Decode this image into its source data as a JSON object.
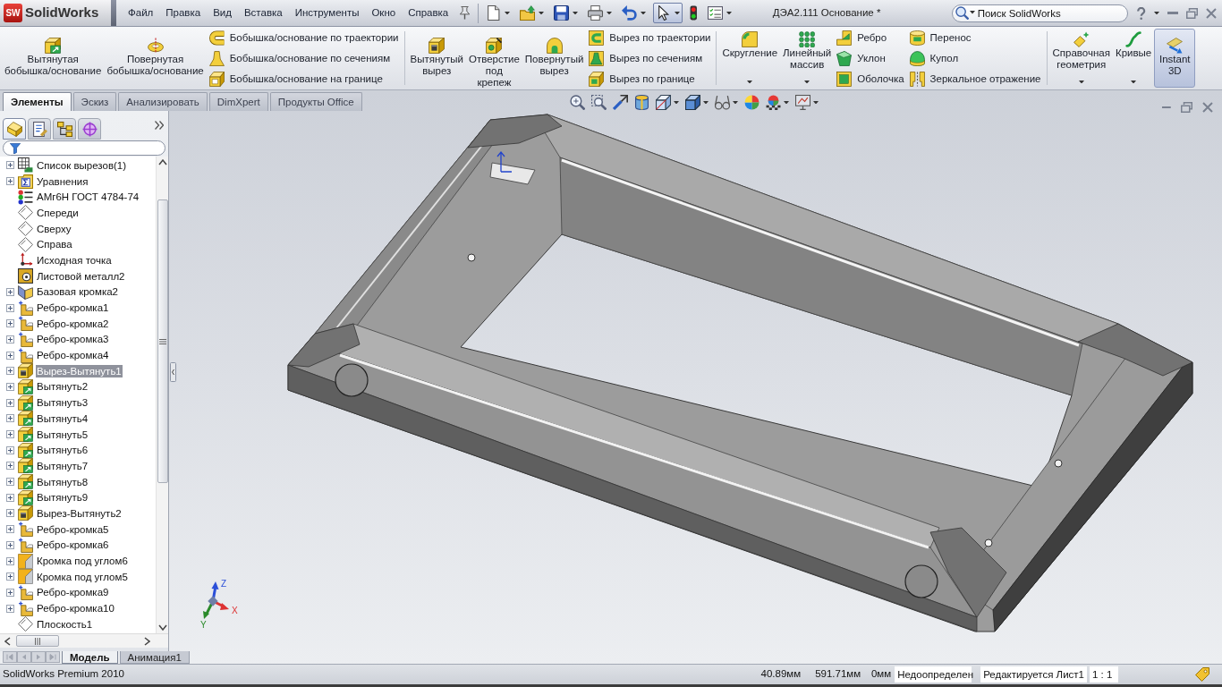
{
  "title_bar": {
    "logo_badge": "SW",
    "logo_text": "SolidWorks",
    "menu": [
      "Файл",
      "Правка",
      "Вид",
      "Вставка",
      "Инструменты",
      "Окно",
      "Справка"
    ],
    "quick_access": [
      {
        "kind": "new",
        "dropdown": true,
        "selected": false
      },
      {
        "kind": "open",
        "dropdown": true,
        "selected": false
      },
      {
        "kind": "save",
        "dropdown": true,
        "selected": false
      },
      {
        "kind": "print",
        "dropdown": true,
        "selected": false
      },
      {
        "kind": "undo",
        "dropdown": true,
        "selected": false
      },
      {
        "kind": "select",
        "dropdown": true,
        "selected": true
      },
      {
        "kind": "rebuild",
        "dropdown": false,
        "selected": false
      },
      {
        "kind": "options",
        "dropdown": true,
        "selected": false
      }
    ],
    "document_title": "ДЭА2.111 Основание *",
    "search": {
      "placeholder": "Поиск SolidWorks"
    }
  },
  "ribbon": {
    "groups": [
      {
        "controls": [
          {
            "kind": "extruded-boss",
            "label": "Вытянутая\nбобышка/основание",
            "dropdown": false,
            "on": false
          },
          {
            "kind": "revolved-boss",
            "label": "Повернутая\nбобышка/основание",
            "dropdown": false,
            "on": false
          },
          {
            "items": [
              {
                "kind": "swept-boss",
                "label": "Бобышка/основание по траектории"
              },
              {
                "kind": "lofted-boss",
                "label": "Бобышка/основание по сечениям"
              },
              {
                "kind": "boundary-boss",
                "label": "Бобышка/основание на границе"
              }
            ]
          }
        ]
      },
      {
        "controls": [
          {
            "kind": "extruded-cut",
            "label": "Вытянутый\nвырез",
            "dropdown": false,
            "on": false
          },
          {
            "kind": "hole-wizard",
            "label": "Отверстие\nпод\nкрепеж",
            "dropdown": false,
            "on": false
          },
          {
            "kind": "revolved-cut",
            "label": "Повернутый\nвырез",
            "dropdown": false,
            "on": false
          },
          {
            "items": [
              {
                "kind": "swept-cut",
                "label": "Вырез по траектории"
              },
              {
                "kind": "lofted-cut",
                "label": "Вырез по сечениям"
              },
              {
                "kind": "boundary-cut",
                "label": "Вырез по границе"
              }
            ]
          }
        ]
      },
      {
        "controls": [
          {
            "kind": "fillet",
            "label": "Скругление",
            "dropdown": true,
            "on": false
          },
          {
            "kind": "linear-pattern",
            "label": "Линейный\nмассив",
            "dropdown": true,
            "on": false
          },
          {
            "items": [
              {
                "kind": "rib",
                "label": "Ребро"
              },
              {
                "kind": "draft",
                "label": "Уклон"
              },
              {
                "kind": "shell",
                "label": "Оболочка"
              }
            ]
          },
          {
            "items": [
              {
                "kind": "wrap",
                "label": "Перенос"
              },
              {
                "kind": "dome",
                "label": "Купол"
              },
              {
                "kind": "mirror",
                "label": "Зеркальное отражение"
              }
            ]
          }
        ]
      },
      {
        "controls": [
          {
            "kind": "reference-geometry",
            "label": "Справочная\nгеометрия",
            "dropdown": true,
            "on": false
          },
          {
            "kind": "curves",
            "label": "Кривые",
            "dropdown": true,
            "on": false
          },
          {
            "kind": "instant-3d",
            "label": "Instant\n3D",
            "dropdown": false,
            "on": true
          }
        ]
      }
    ]
  },
  "command_tabs": [
    {
      "label": "Элементы",
      "selected": true
    },
    {
      "label": "Эскиз",
      "selected": false
    },
    {
      "label": "Анализировать",
      "selected": false
    },
    {
      "label": "DimXpert",
      "selected": false
    },
    {
      "label": "Продукты Office",
      "selected": false
    }
  ],
  "view_toolbar": [
    {
      "kind": "zoom-fit",
      "dropdown": false
    },
    {
      "kind": "zoom-area",
      "dropdown": false
    },
    {
      "kind": "previous-view",
      "dropdown": false
    },
    {
      "kind": "section",
      "dropdown": false
    },
    {
      "kind": "orientation",
      "dropdown": true
    },
    {
      "kind": "display-style",
      "dropdown": true
    },
    {
      "kind": "hide-show",
      "dropdown": true
    },
    {
      "kind": "appearance",
      "dropdown": false
    },
    {
      "kind": "scene",
      "dropdown": true
    },
    {
      "kind": "view-settings",
      "dropdown": true
    }
  ],
  "feature_manager": {
    "tabs": [
      {
        "kind": "features",
        "selected": true
      },
      {
        "kind": "properties",
        "selected": false
      },
      {
        "kind": "configurations",
        "selected": false
      },
      {
        "kind": "dimxpert",
        "selected": false
      }
    ],
    "tree": [
      {
        "label": "Список вырезов(1)",
        "kind": "cut-list",
        "expandable": true,
        "expanded": false,
        "selected": false
      },
      {
        "label": "Уравнения",
        "kind": "equations",
        "expandable": true,
        "expanded": false,
        "selected": false
      },
      {
        "label": "АМг6Н ГОСТ 4784-74",
        "kind": "material",
        "expandable": false,
        "selected": false
      },
      {
        "label": "Спереди",
        "kind": "plane",
        "expandable": false,
        "selected": false
      },
      {
        "label": "Сверху",
        "kind": "plane",
        "expandable": false,
        "selected": false
      },
      {
        "label": "Справа",
        "kind": "plane",
        "expandable": false,
        "selected": false
      },
      {
        "label": "Исходная точка",
        "kind": "origin",
        "expandable": false,
        "selected": false
      },
      {
        "label": "Листовой металл2",
        "kind": "sheet-metal",
        "expandable": false,
        "selected": false
      },
      {
        "label": "Базовая кромка2",
        "kind": "base-flange",
        "expandable": true,
        "expanded": false,
        "selected": false
      },
      {
        "label": "Ребро-кромка1",
        "kind": "edge-flange",
        "expandable": true,
        "expanded": false,
        "selected": false
      },
      {
        "label": "Ребро-кромка2",
        "kind": "edge-flange",
        "expandable": true,
        "expanded": false,
        "selected": false
      },
      {
        "label": "Ребро-кромка3",
        "kind": "edge-flange",
        "expandable": true,
        "expanded": false,
        "selected": false
      },
      {
        "label": "Ребро-кромка4",
        "kind": "edge-flange",
        "expandable": true,
        "expanded": false,
        "selected": false
      },
      {
        "label": "Вырез-Вытянуть1",
        "kind": "extruded-cut",
        "expandable": true,
        "expanded": false,
        "selected": true
      },
      {
        "label": "Вытянуть2",
        "kind": "extrude",
        "expandable": true,
        "expanded": false,
        "selected": false
      },
      {
        "label": "Вытянуть3",
        "kind": "extrude",
        "expandable": true,
        "expanded": false,
        "selected": false
      },
      {
        "label": "Вытянуть4",
        "kind": "extrude",
        "expandable": true,
        "expanded": false,
        "selected": false
      },
      {
        "label": "Вытянуть5",
        "kind": "extrude",
        "expandable": true,
        "expanded": false,
        "selected": false
      },
      {
        "label": "Вытянуть6",
        "kind": "extrude",
        "expandable": true,
        "expanded": false,
        "selected": false
      },
      {
        "label": "Вытянуть7",
        "kind": "extrude",
        "expandable": true,
        "expanded": false,
        "selected": false
      },
      {
        "label": "Вытянуть8",
        "kind": "extrude",
        "expandable": true,
        "expanded": false,
        "selected": false
      },
      {
        "label": "Вытянуть9",
        "kind": "extrude",
        "expandable": true,
        "expanded": false,
        "selected": false
      },
      {
        "label": "Вырез-Вытянуть2",
        "kind": "extruded-cut",
        "expandable": true,
        "expanded": false,
        "selected": false
      },
      {
        "label": "Ребро-кромка5",
        "kind": "edge-flange",
        "expandable": true,
        "expanded": false,
        "selected": false
      },
      {
        "label": "Ребро-кромка6",
        "kind": "edge-flange",
        "expandable": true,
        "expanded": false,
        "selected": false
      },
      {
        "label": "Кромка под углом6",
        "kind": "miter-flange",
        "expandable": true,
        "expanded": false,
        "selected": false
      },
      {
        "label": "Кромка под углом5",
        "kind": "miter-flange",
        "expandable": true,
        "expanded": false,
        "selected": false
      },
      {
        "label": "Ребро-кромка9",
        "kind": "edge-flange",
        "expandable": true,
        "expanded": false,
        "selected": false
      },
      {
        "label": "Ребро-кромка10",
        "kind": "edge-flange",
        "expandable": true,
        "expanded": false,
        "selected": false
      },
      {
        "label": "Плоскость1",
        "kind": "plane",
        "expandable": false,
        "selected": false
      }
    ]
  },
  "viewport": {
    "triad": {
      "x": "X",
      "y": "Y",
      "z": "Z"
    }
  },
  "bottom_tabs": [
    {
      "label": "Модель",
      "selected": true
    },
    {
      "label": "Анимация1",
      "selected": false
    }
  ],
  "status_bar": {
    "product": "SolidWorks Premium 2010",
    "readouts": [
      "40.89мм",
      "591.71мм",
      "0мм"
    ],
    "definition": "Недоопределен",
    "editing": "Редактируется Лист1",
    "scale": "1 : 1"
  }
}
